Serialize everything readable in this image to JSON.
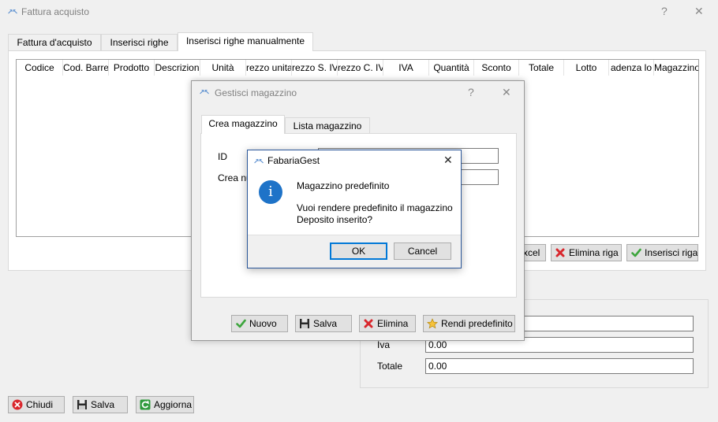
{
  "main_window": {
    "title": "Fattura acquisto",
    "help_glyph": "?",
    "close_glyph": "✕",
    "tabs": [
      {
        "label": "Fattura d'acquisto"
      },
      {
        "label": "Inserisci righe"
      },
      {
        "label": "Inserisci righe manualmente"
      }
    ],
    "grid_columns": [
      "Codice",
      "Cod. Barre",
      "Prodotto",
      "Descrizion",
      "Unità",
      "rezzo unita",
      "rezzo S. IV",
      "rezzo C. IV",
      "IVA",
      "Quantità",
      "Sconto",
      "Totale",
      "Lotto",
      "adenza lo",
      "Magazzino"
    ],
    "row_buttons": {
      "excel_label": "xcel",
      "delete_row_label": "Elimina riga",
      "insert_rows_label": "Inserisci riga"
    },
    "totals": {
      "iva_label": "Iva",
      "iva_value": "0.00",
      "totale_label": "Totale",
      "totale_value": "0.00"
    },
    "footer_buttons": {
      "close_label": "Chiudi",
      "save_label": "Salva",
      "refresh_label": "Aggiorna"
    }
  },
  "warehouse_dialog": {
    "title": "Gestisci magazzino",
    "help_glyph": "?",
    "close_glyph": "✕",
    "tabs": [
      {
        "label": "Crea magazzino"
      },
      {
        "label": "Lista magazzino"
      }
    ],
    "id_label": "ID",
    "create_label": "Crea nu",
    "buttons": {
      "new_label": "Nuovo",
      "save_label": "Salva",
      "delete_label": "Elimina",
      "default_label": "Rendi predefinito"
    }
  },
  "message_box": {
    "title": "FabariaGest",
    "close_glyph": "✕",
    "info_glyph": "i",
    "heading": "Magazzino predefinito",
    "line1": "Vuoi rendere predefinito il magazzino",
    "line2": "Deposito inserito?",
    "ok_label": "OK",
    "cancel_label": "Cancel"
  },
  "app_icon_glyph": "↗↖",
  "colors": {
    "accent_blue": "#2b579a",
    "info_blue": "#1e73c8",
    "delete_red": "#d9262c",
    "check_green": "#3ca53c"
  }
}
